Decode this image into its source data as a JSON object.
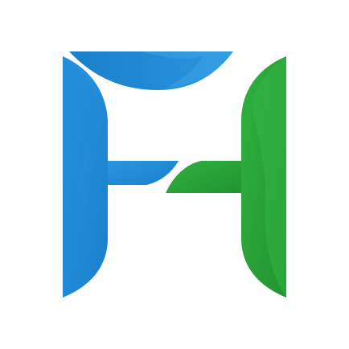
{
  "logo": {
    "icon": "fh-monogram-logo",
    "colors": {
      "blue": "#1E8AD6",
      "blue_light": "#3AA0E4",
      "blue_dark": "#1677C2",
      "green": "#2BA73A",
      "green_light": "#3DBB4B",
      "green_dark": "#23952F",
      "background": "#FFFFFF"
    }
  }
}
